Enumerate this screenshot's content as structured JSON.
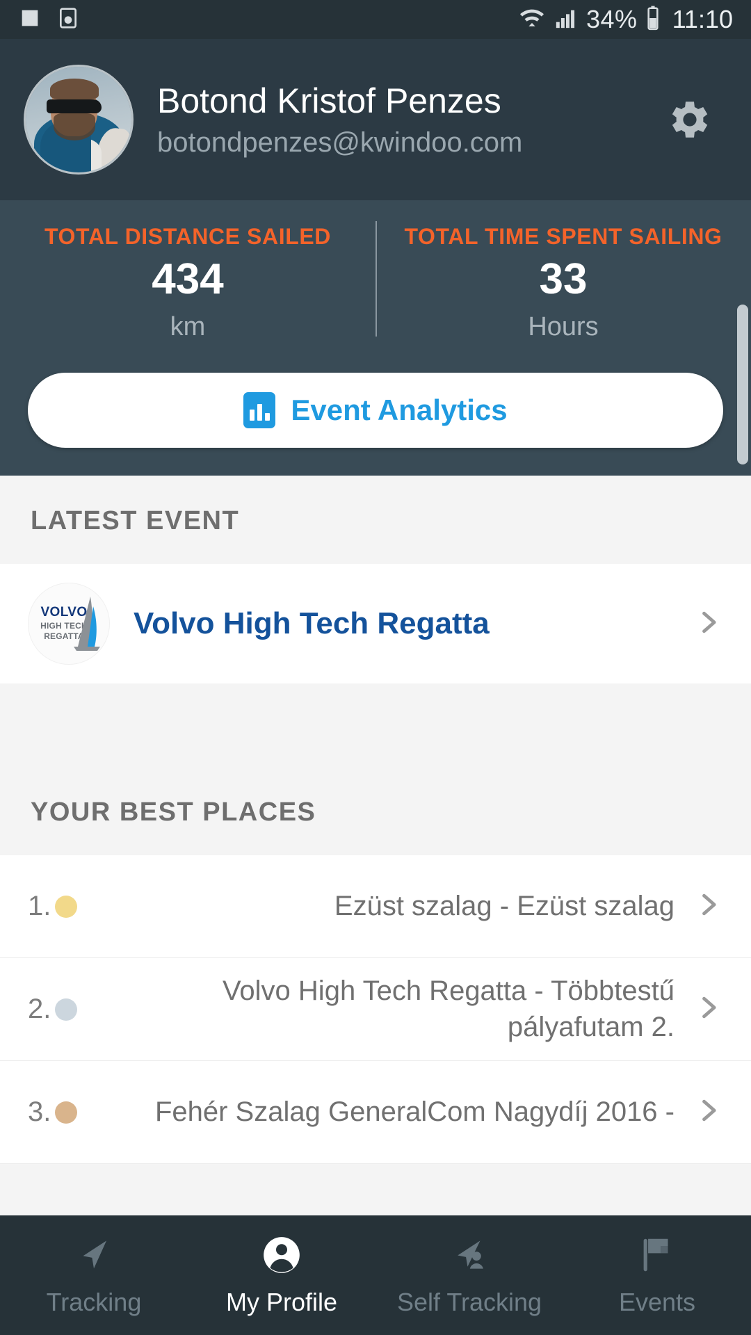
{
  "status_bar": {
    "icons": [
      "image-icon",
      "screen-recorder-icon",
      "wifi-icon",
      "signal-icon",
      "battery-icon"
    ],
    "battery_percent": "34%",
    "clock": "11:10"
  },
  "profile": {
    "avatar": "user-avatar",
    "name": "Botond Kristof Penzes",
    "email": "botondpenzes@kwindoo.com",
    "settings_icon": "gear-icon"
  },
  "stats": {
    "items": [
      {
        "label": "TOTAL DISTANCE SAILED",
        "value": "434",
        "unit": "km"
      },
      {
        "label": "TOTAL TIME SPENT SAILING",
        "value": "33",
        "unit": "Hours"
      }
    ],
    "accent_color": "#f4632a"
  },
  "analytics_button": {
    "label": "Event Analytics",
    "icon": "bar-chart-icon",
    "color": "#1f9ae0"
  },
  "latest_event": {
    "section_title": "LATEST EVENT",
    "logo_lines": {
      "brand": "VOLVO",
      "line2": "HIGH TECH",
      "line3": "REGATTA"
    },
    "title": "Volvo High Tech Regatta",
    "chevron": "chevron-right-icon"
  },
  "best_places": {
    "section_title": "YOUR BEST PLACES",
    "rows": [
      {
        "rank": "1.",
        "medal": "gold",
        "name": "Ezüst szalag - Ezüst szalag"
      },
      {
        "rank": "2.",
        "medal": "silver",
        "name": "Volvo High Tech Regatta - Többtestű pályafutam 2."
      },
      {
        "rank": "3.",
        "medal": "bronze",
        "name": "Fehér Szalag GeneralCom Nagydíj 2016 -"
      }
    ]
  },
  "bottom_nav": {
    "items": [
      {
        "label": "Tracking",
        "icon": "navigation-arrow-icon",
        "active": false
      },
      {
        "label": "My Profile",
        "icon": "person-circle-icon",
        "active": true
      },
      {
        "label": "Self Tracking",
        "icon": "navigation-person-icon",
        "active": false
      },
      {
        "label": "Events",
        "icon": "flag-icon",
        "active": false
      }
    ]
  }
}
